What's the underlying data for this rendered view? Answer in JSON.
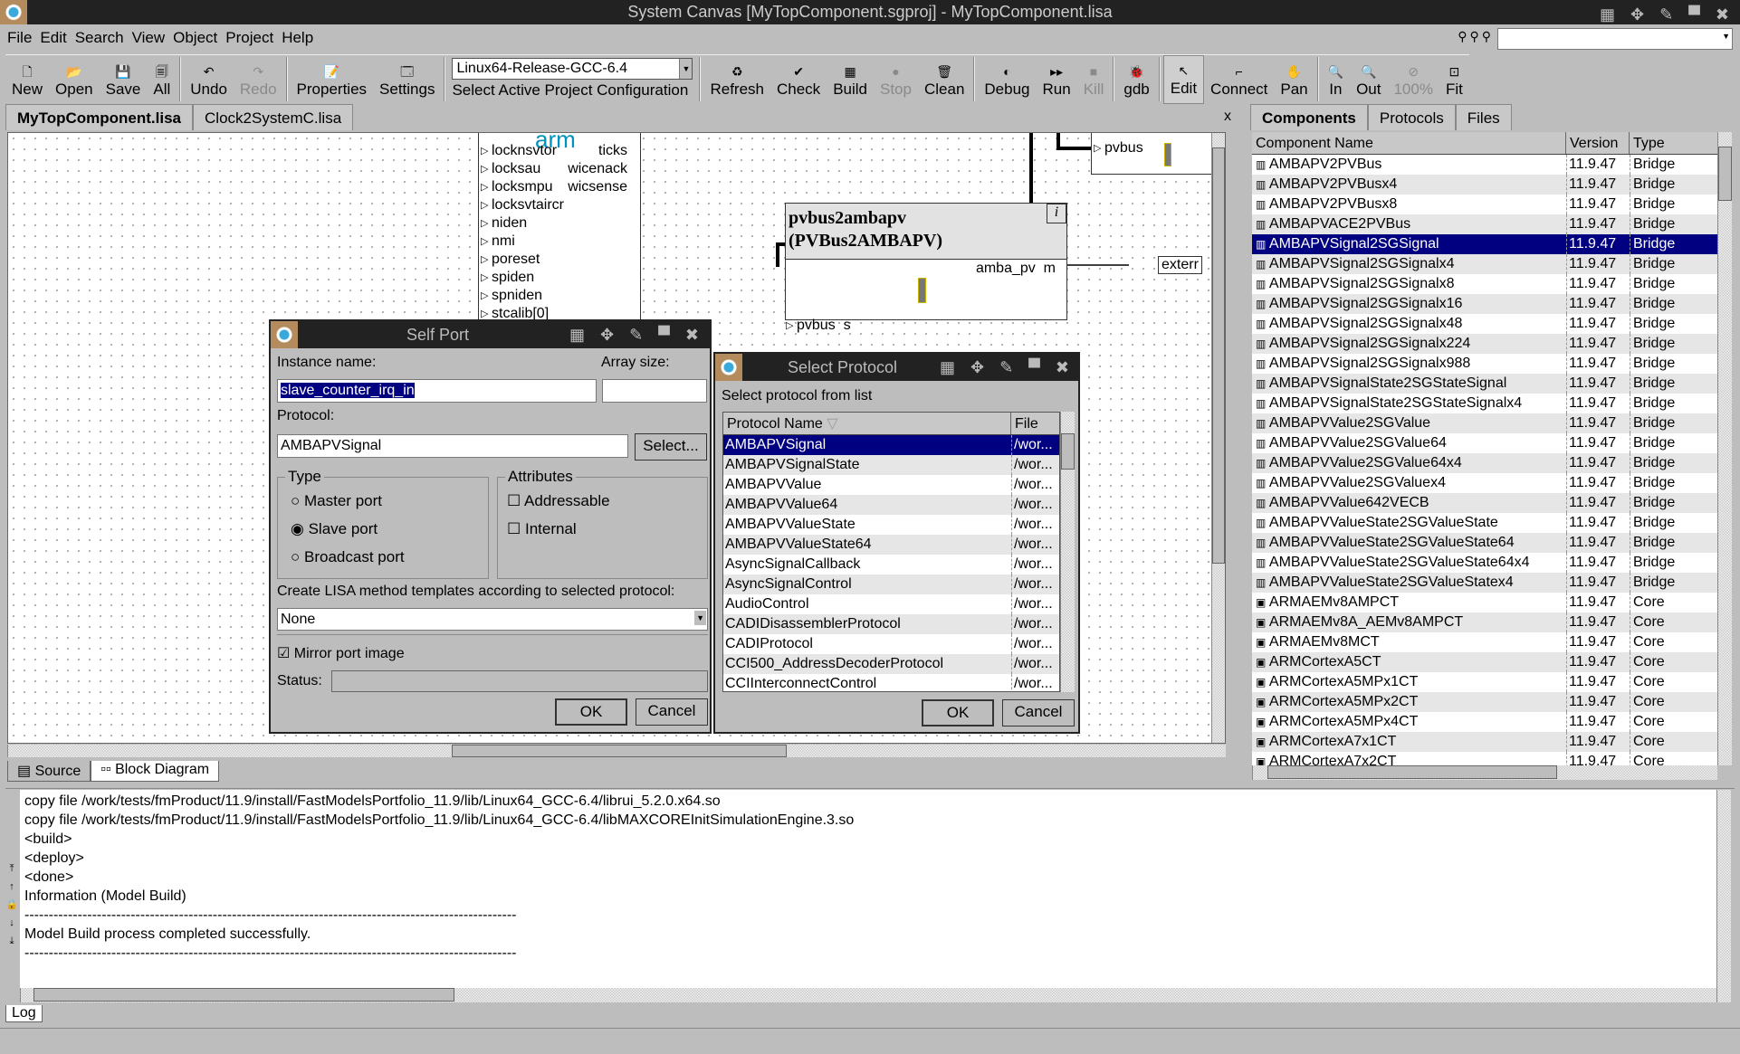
{
  "window": {
    "title": "System Canvas [MyTopComponent.sgproj] - MyTopComponent.lisa",
    "controls": "▦ ✥ ✎ ▀ ✖"
  },
  "menu": [
    "File",
    "Edit",
    "Search",
    "View",
    "Object",
    "Project",
    "Help"
  ],
  "find": {
    "icons": [
      "find-icon",
      "find-next-icon",
      "find-prev-icon"
    ],
    "value": ""
  },
  "toolbar": {
    "file": [
      {
        "label": "New",
        "icon": "🗋"
      },
      {
        "label": "Open",
        "icon": "📂"
      },
      {
        "label": "Save",
        "icon": "💾"
      },
      {
        "label": "All",
        "icon": "🗐"
      }
    ],
    "edit": [
      {
        "label": "Undo",
        "icon": "↶"
      },
      {
        "label": "Redo",
        "icon": "↷",
        "disabled": true
      }
    ],
    "project": [
      {
        "label": "Properties",
        "icon": "📝"
      },
      {
        "label": "Settings",
        "icon": "🗔"
      }
    ],
    "config": {
      "value": "Linux64-Release-GCC-6.4",
      "label": "Select Active Project Configuration"
    },
    "build": [
      {
        "label": "Refresh",
        "icon": "♻"
      },
      {
        "label": "Check",
        "icon": "✔"
      },
      {
        "label": "Build",
        "icon": "▦"
      },
      {
        "label": "Stop",
        "icon": "●",
        "disabled": true
      },
      {
        "label": "Clean",
        "icon": "🗑"
      }
    ],
    "run": [
      {
        "label": "Debug",
        "icon": "◐"
      },
      {
        "label": "Run",
        "icon": "▸▸"
      },
      {
        "label": "Kill",
        "icon": "■",
        "disabled": true
      }
    ],
    "gdb": [
      {
        "label": "gdb",
        "icon": "🐞"
      }
    ],
    "mode": [
      {
        "label": "Edit",
        "icon": "↖",
        "active": true
      },
      {
        "label": "Connect",
        "icon": "⌐"
      },
      {
        "label": "Pan",
        "icon": "✋"
      }
    ],
    "zoom": [
      {
        "label": "In",
        "icon": "🔍"
      },
      {
        "label": "Out",
        "icon": "🔍"
      },
      {
        "label": "100%",
        "icon": "⊘",
        "disabled": true
      },
      {
        "label": "Fit",
        "icon": "⊡"
      }
    ]
  },
  "editor_tabs": [
    "MyTopComponent.lisa",
    "Clock2SystemC.lisa"
  ],
  "editor_close": "x",
  "canvas": {
    "arm_logo": "arm",
    "arm_ports_left": [
      "locknsvtor",
      "locksau",
      "locksmpu",
      "locksvtaircr",
      "niden",
      "nmi",
      "poreset",
      "spiden",
      "spniden",
      "stcalib[0]"
    ],
    "arm_ports_right": [
      "ticks",
      "wicenack",
      "wicsense"
    ],
    "block": {
      "name": "pvbus2ambapv",
      "type": "(PVBus2AMBAPV)",
      "info": "i",
      "port_in": "pvbus  s",
      "port_out": "amba_pv  m"
    },
    "top_block_port": "pvbus",
    "external_port": "exterr"
  },
  "view_tabs": [
    "Source",
    "Block Diagram"
  ],
  "right_tabs": [
    "Components",
    "Protocols",
    "Files"
  ],
  "components": {
    "columns": [
      "Component Name",
      "Version",
      "Type"
    ],
    "selected": 4,
    "rows": [
      [
        "AMBAPV2PVBus",
        "11.9.47",
        "Bridge"
      ],
      [
        "AMBAPV2PVBusx4",
        "11.9.47",
        "Bridge"
      ],
      [
        "AMBAPV2PVBusx8",
        "11.9.47",
        "Bridge"
      ],
      [
        "AMBAPVACE2PVBus",
        "11.9.47",
        "Bridge"
      ],
      [
        "AMBAPVSignal2SGSignal",
        "11.9.47",
        "Bridge"
      ],
      [
        "AMBAPVSignal2SGSignalx4",
        "11.9.47",
        "Bridge"
      ],
      [
        "AMBAPVSignal2SGSignalx8",
        "11.9.47",
        "Bridge"
      ],
      [
        "AMBAPVSignal2SGSignalx16",
        "11.9.47",
        "Bridge"
      ],
      [
        "AMBAPVSignal2SGSignalx48",
        "11.9.47",
        "Bridge"
      ],
      [
        "AMBAPVSignal2SGSignalx224",
        "11.9.47",
        "Bridge"
      ],
      [
        "AMBAPVSignal2SGSignalx988",
        "11.9.47",
        "Bridge"
      ],
      [
        "AMBAPVSignalState2SGStateSignal",
        "11.9.47",
        "Bridge"
      ],
      [
        "AMBAPVSignalState2SGStateSignalx4",
        "11.9.47",
        "Bridge"
      ],
      [
        "AMBAPVValue2SGValue",
        "11.9.47",
        "Bridge"
      ],
      [
        "AMBAPVValue2SGValue64",
        "11.9.47",
        "Bridge"
      ],
      [
        "AMBAPVValue2SGValue64x4",
        "11.9.47",
        "Bridge"
      ],
      [
        "AMBAPVValue2SGValuex4",
        "11.9.47",
        "Bridge"
      ],
      [
        "AMBAPVValue642VECB",
        "11.9.47",
        "Bridge"
      ],
      [
        "AMBAPVValueState2SGValueState",
        "11.9.47",
        "Bridge"
      ],
      [
        "AMBAPVValueState2SGValueState64",
        "11.9.47",
        "Bridge"
      ],
      [
        "AMBAPVValueState2SGValueState64x4",
        "11.9.47",
        "Bridge"
      ],
      [
        "AMBAPVValueState2SGValueStatex4",
        "11.9.47",
        "Bridge"
      ],
      [
        "ARMAEMv8AMPCT",
        "11.9.47",
        "Core"
      ],
      [
        "ARMAEMv8A_AEMv8AMPCT",
        "11.9.47",
        "Core"
      ],
      [
        "ARMAEMv8MCT",
        "11.9.47",
        "Core"
      ],
      [
        "ARMCortexA5CT",
        "11.9.47",
        "Core"
      ],
      [
        "ARMCortexA5MPx1CT",
        "11.9.47",
        "Core"
      ],
      [
        "ARMCortexA5MPx2CT",
        "11.9.47",
        "Core"
      ],
      [
        "ARMCortexA5MPx4CT",
        "11.9.47",
        "Core"
      ],
      [
        "ARMCortexA7x1CT",
        "11.9.47",
        "Core"
      ],
      [
        "ARMCortexA7x2CT",
        "11.9.47",
        "Core"
      ]
    ]
  },
  "log": {
    "lines": [
      "copy file /work/tests/fmProduct/11.9/install/FastModelsPortfolio_11.9/lib/Linux64_GCC-6.4/librui_5.2.0.x64.so",
      "copy file /work/tests/fmProduct/11.9/install/FastModelsPortfolio_11.9/lib/Linux64_GCC-6.4/libMAXCOREInitSimulationEngine.3.so",
      "<build>",
      "<deploy>",
      "<done>",
      "Information (Model Build)",
      "------------------------------------------------------------------------------------------------------",
      "Model Build process completed successfully.",
      "------------------------------------------------------------------------------------------------------"
    ],
    "tab": "Log"
  },
  "self_port": {
    "title": "Self Port",
    "instance_label": "Instance name:",
    "instance_value": "slave_counter_irq_in",
    "array_label": "Array size:",
    "array_value": "",
    "protocol_label": "Protocol:",
    "protocol_value": "AMBAPVSignal",
    "select_btn": "Select...",
    "type_label": "Type",
    "types": [
      "Master port",
      "Slave port",
      "Broadcast port"
    ],
    "type_selected": 1,
    "attr_label": "Attributes",
    "attrs": [
      "Addressable",
      "Internal"
    ],
    "lisa_label": "Create LISA method templates according to selected protocol:",
    "lisa_value": "None",
    "mirror_label": "Mirror port image",
    "mirror_checked": true,
    "status_label": "Status:",
    "status_value": "",
    "ok": "OK",
    "cancel": "Cancel"
  },
  "select_protocol": {
    "title": "Select Protocol",
    "prompt": "Select protocol from list",
    "columns": [
      "Protocol Name",
      "File"
    ],
    "selected": 0,
    "rows": [
      "AMBAPVSignal",
      "AMBAPVSignalState",
      "AMBAPVValue",
      "AMBAPVValue64",
      "AMBAPVValueState",
      "AMBAPVValueState64",
      "AsyncSignalCallback",
      "AsyncSignalControl",
      "AudioControl",
      "CADIDisassemblerProtocol",
      "CADIProtocol",
      "CCI500_AddressDecoderProtocol",
      "CCIInterconnectControl"
    ],
    "file_value": "/wor...",
    "ok": "OK",
    "cancel": "Cancel"
  },
  "colors": {
    "selection": "#000080",
    "titlebar": "#222222",
    "background": "#bdbdbd"
  }
}
